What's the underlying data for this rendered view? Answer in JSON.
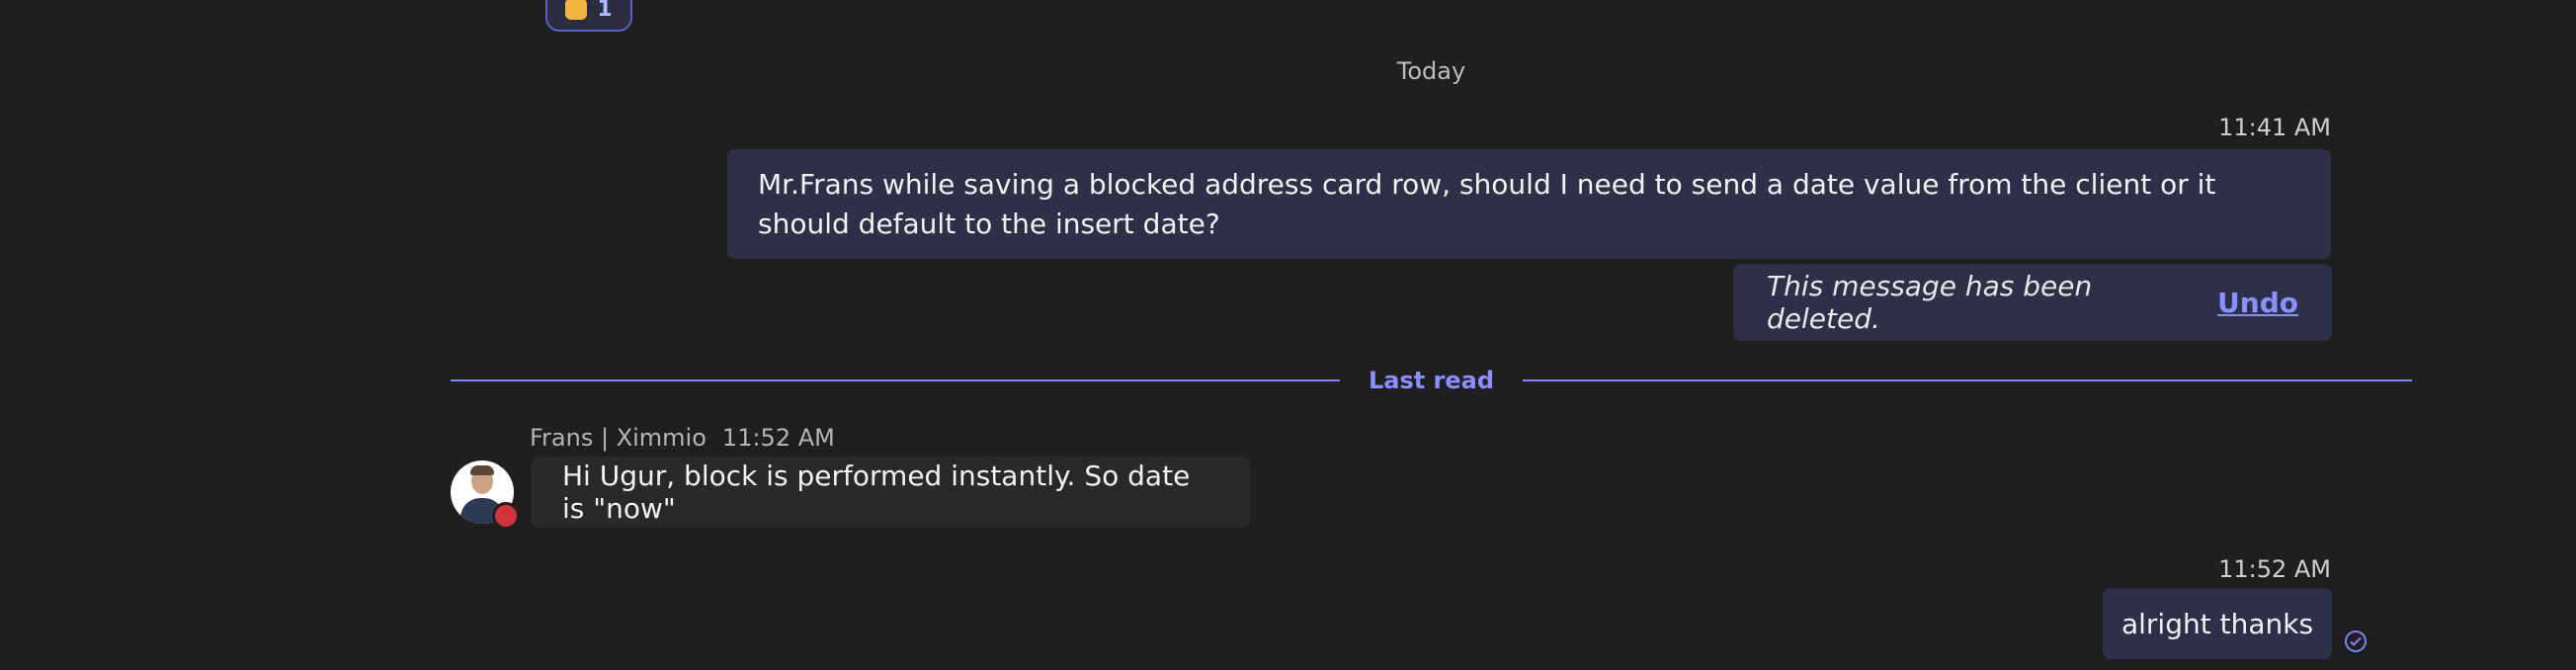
{
  "reaction": {
    "emoji": "thumbs-up",
    "count": "1"
  },
  "day_divider": "Today",
  "messages": [
    {
      "time": "11:41 AM",
      "text": "Mr.Frans while saving a blocked address card row, should I need to send a date value from the client or it should default to the insert date?"
    },
    {
      "deleted_text": "This message has been deleted.",
      "undo_label": "Undo"
    },
    {
      "sender": "Frans | Ximmio",
      "time": "11:52 AM",
      "text": "Hi Ugur, block is performed instantly. So date is \"now\""
    },
    {
      "time": "11:52 AM",
      "text": "alright thanks"
    }
  ],
  "last_read_label": "Last read",
  "colors": {
    "background": "#1f1f1f",
    "my_bubble": "#2e2f48",
    "other_bubble": "#292929",
    "accent": "#7f85f5",
    "presence_busy": "#d13438"
  }
}
